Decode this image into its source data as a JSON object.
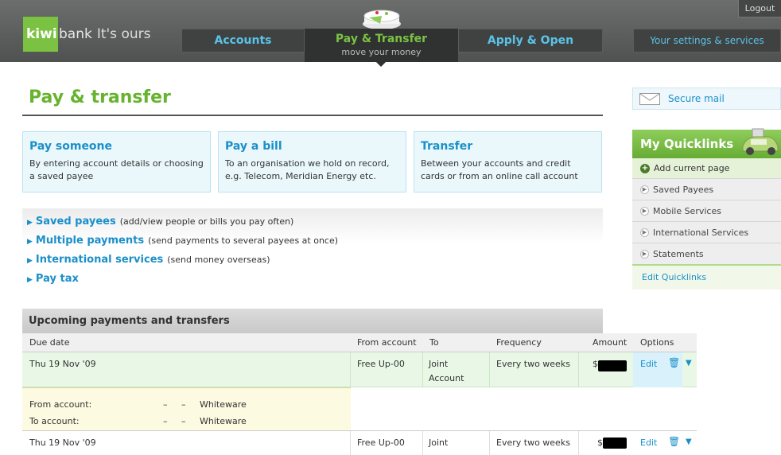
{
  "brand": {
    "logo_box": "kiwi",
    "logo_word": "bank",
    "tagline": "It's ours"
  },
  "header": {
    "logout": "Logout",
    "tabs": {
      "accounts": "Accounts",
      "pay_transfer": "Pay & Transfer",
      "pay_transfer_sub": "move your money",
      "apply_open": "Apply & Open"
    },
    "settings": "Your settings & services"
  },
  "main": {
    "title": "Pay & transfer",
    "cards": [
      {
        "title": "Pay someone",
        "desc": "By entering account details or choosing a saved payee"
      },
      {
        "title": "Pay a bill",
        "desc": "To an organisation we hold on record, e.g. Telecom, Meridian Energy etc."
      },
      {
        "title": "Transfer",
        "desc": "Between your accounts and credit cards or from an online call account"
      }
    ],
    "links": [
      {
        "label": "Saved payees",
        "desc": "(add/view people or bills you pay often)"
      },
      {
        "label": "Multiple payments",
        "desc": "(send payments to several payees at once)"
      },
      {
        "label": "International services",
        "desc": "(send money overseas)"
      },
      {
        "label": "Pay tax",
        "desc": ""
      }
    ]
  },
  "upcoming": {
    "title": "Upcoming payments and transfers",
    "columns": {
      "due": "Due date",
      "from": "From account",
      "to": "To",
      "frequency": "Frequency",
      "amount": "Amount",
      "options": "Options"
    },
    "rows": [
      {
        "due": "Thu 19 Nov '09",
        "from": "Free Up-00",
        "to": "Joint Account",
        "frequency": "Every two weeks",
        "amount_prefix": "$",
        "edit": "Edit"
      },
      {
        "due": "Thu 19 Nov '09",
        "from": "Free Up-00",
        "to": "Joint",
        "frequency": "Every two weeks",
        "amount_prefix": "$",
        "edit": "Edit"
      }
    ],
    "detail": {
      "from_label": "From account:",
      "from_dash1": "–",
      "from_dash2": "–",
      "from_value": "Whiteware",
      "to_label": "To account:",
      "to_dash1": "–",
      "to_dash2": "–",
      "to_value": "Whiteware"
    }
  },
  "sidebar": {
    "secure_mail": "Secure mail",
    "quicklinks_title": "My Quicklinks",
    "add_current": "Add current page",
    "items": [
      "Saved Payees",
      "Mobile Services",
      "International Services",
      "Statements"
    ],
    "edit": "Edit Quicklinks"
  },
  "colors": {
    "brand_green": "#7cc242",
    "link_blue": "#1a8fc9",
    "nav_blue": "#5bc3e8"
  }
}
